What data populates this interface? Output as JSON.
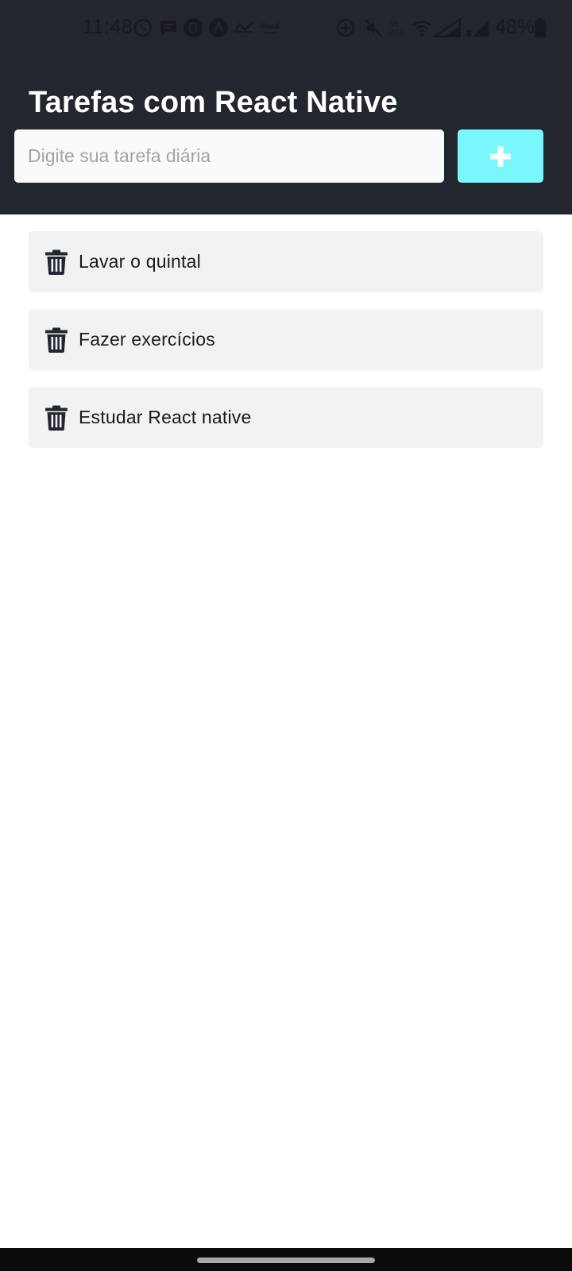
{
  "status_bar": {
    "time": "11:48",
    "battery": "48%",
    "icons": [
      "whatsapp-icon",
      "message-icon",
      "ifood-icon",
      "arrow-up-icon",
      "graph-icon",
      "ifood-logo-icon",
      "sync-icon",
      "mute-icon",
      "volte-icon",
      "wifi-icon",
      "signal-icon",
      "signal-icon-2",
      "battery-icon"
    ]
  },
  "app": {
    "title": "Tarefas com React Native"
  },
  "input": {
    "placeholder": "Digite sua tarefa diária",
    "value": ""
  },
  "add_button": {
    "icon": "plus-icon",
    "color": "#7af7fc"
  },
  "tasks": [
    {
      "label": "Lavar o quintal"
    },
    {
      "label": "Fazer exercícios"
    },
    {
      "label": "Estudar React native"
    }
  ],
  "colors": {
    "header_bg": "#22262e",
    "task_bg": "#f2f2f2",
    "accent": "#7af7fc"
  }
}
